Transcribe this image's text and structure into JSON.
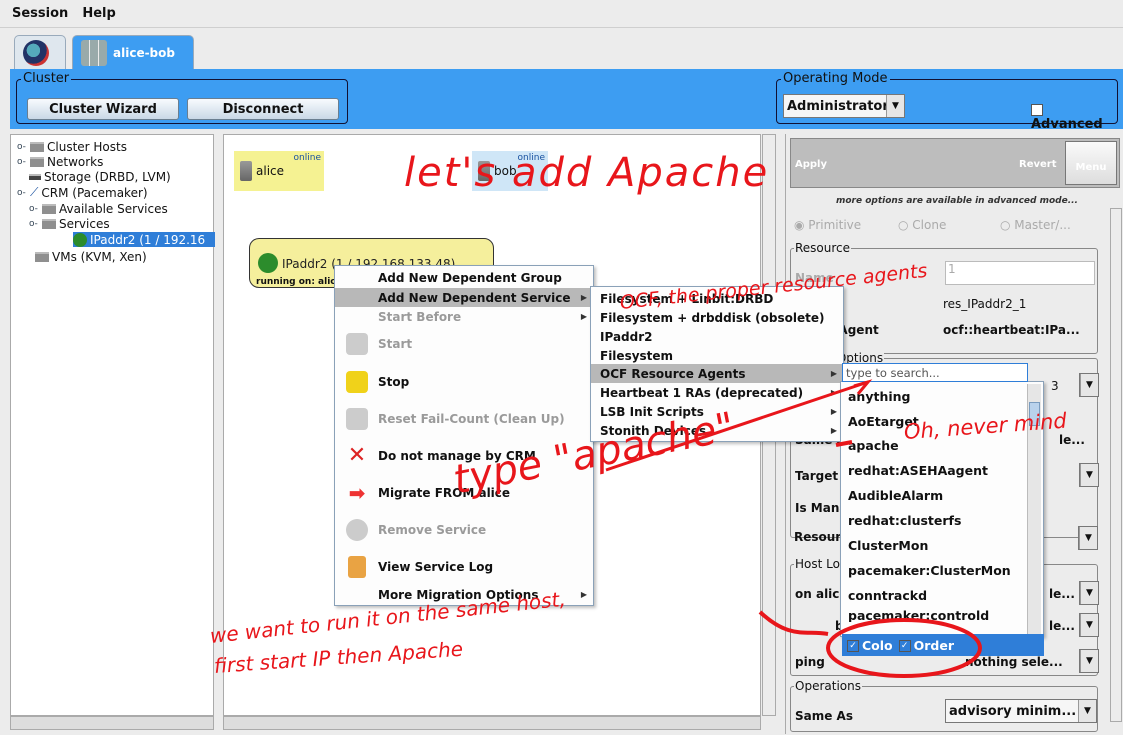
{
  "menubar": {
    "session": "Session",
    "help": "Help"
  },
  "tabs": {
    "cluster_tab": "alice-bob"
  },
  "cluster": {
    "title": "Cluster",
    "wizard": "Cluster Wizard",
    "disconnect": "Disconnect"
  },
  "operating_mode": {
    "title": "Operating Mode",
    "value": "Administrator",
    "advanced": "Advanced"
  },
  "tree": {
    "cluster_hosts": "Cluster Hosts",
    "networks": "Networks",
    "storage": "Storage (DRBD, LVM)",
    "crm": "CRM (Pacemaker)",
    "available_services": "Available Services",
    "services": "Services",
    "ipaddr": "IPaddr2 (1 / 192.16",
    "vms": "VMs (KVM, Xen)"
  },
  "graph": {
    "host1": "alice",
    "host2": "bob",
    "status1": "online",
    "status2": "online",
    "service_name": "IPaddr2 (1 / 192.168.133.48)",
    "service_run": "running on: alice"
  },
  "context_menu": {
    "items": [
      "Add New Dependent Group",
      "Add New Dependent Service",
      "Start Before",
      "Start",
      "Stop",
      "Reset Fail-Count (Clean Up)",
      "Do not manage by CRM",
      "Migrate FROM alice",
      "Remove Service",
      "View Service Log",
      "More Migration Options"
    ]
  },
  "submenu": {
    "items": [
      "Filesystem + Linbit:DRBD",
      "Filesystem + drbddisk (obsolete)",
      "IPaddr2",
      "Filesystem",
      "OCF Resource Agents",
      "Heartbeat 1 RAs (deprecated)",
      "LSB Init Scripts",
      "Stonith Devices"
    ]
  },
  "agent_list": {
    "search_placeholder": "type to search...",
    "items": [
      "anything",
      "AoEtarget",
      "apache",
      "redhat:ASEHAagent",
      "AudibleAlarm",
      "redhat:clusterfs",
      "ClusterMon",
      "pacemaker:ClusterMon",
      "conntrackd",
      "pacemaker:controld"
    ],
    "colo": "Colo",
    "order": "Order"
  },
  "right_panel": {
    "apply": "Apply",
    "revert": "Revert",
    "menu": "Menu",
    "hint": "more options are available in advanced mode...",
    "primitive": "Primitive",
    "clone": "Clone",
    "master": "Master/...",
    "resource_title": "Resource",
    "name_label": "Name",
    "name_value": "1",
    "res_id": "res_IPaddr2_1",
    "agent_label": "ce Agent",
    "agent_value": "ocf::heartbeat:IPa...",
    "ed_options": "ed Options",
    "val_3": "3",
    "same_label": "Same A",
    "sele": "le...",
    "target": "Target",
    "is_mana": "Is Mana",
    "resour": "Resour",
    "host_lo": "Host Lo",
    "on_alice": "on alice",
    "on_bob": "bob",
    "ping": "ping",
    "nothing_sele": "nothing sele...",
    "operations": "Operations",
    "same_as": "Same As",
    "advisory": "advisory minim..."
  },
  "annotations": {
    "title": "let's add Apache",
    "ocf": "OCF, the proper resource agents",
    "oh": "Oh, never mind",
    "type": "type \"apache\"",
    "same_host_1": "we want to run it on the same host,",
    "same_host_2": "first start IP then Apache"
  },
  "colors": {
    "accent": "#3d9df2",
    "annotation": "#e8161b",
    "selection": "#2f7ed8"
  }
}
